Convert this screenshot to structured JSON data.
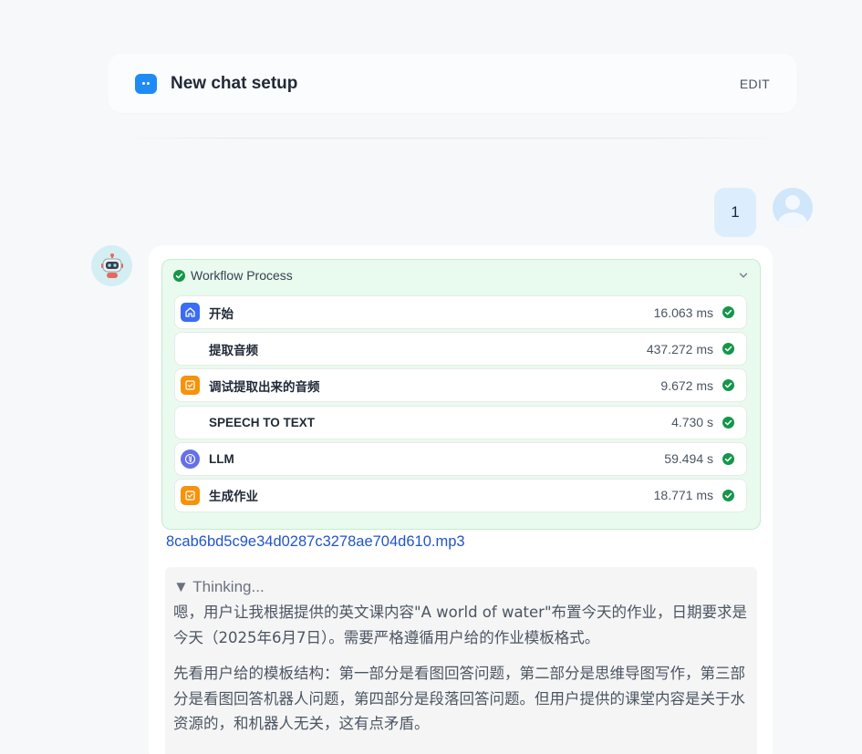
{
  "header": {
    "title": "New chat setup",
    "edit_label": "EDIT"
  },
  "user_message": {
    "text": "1"
  },
  "workflow": {
    "title": "Workflow Process",
    "status_color": "#22a355",
    "nodes": [
      {
        "name": "开始",
        "time": "16.063 ms",
        "icon": "home-icon",
        "icon_color": "#3b6cf6"
      },
      {
        "name": "提取音频",
        "time": "437.272 ms",
        "icon": "blank-icon",
        "icon_color": "#ffffff"
      },
      {
        "name": "调试提取出来的音频",
        "time": "9.672 ms",
        "icon": "code-icon",
        "icon_color": "#f5930b"
      },
      {
        "name": "SPEECH TO TEXT",
        "time": "4.730 s",
        "icon": "blank-icon",
        "icon_color": "#ffffff"
      },
      {
        "name": "LLM",
        "time": "59.494 s",
        "icon": "llm-icon",
        "icon_color": "#6470e8"
      },
      {
        "name": "生成作业",
        "time": "18.771 ms",
        "icon": "code-icon",
        "icon_color": "#f5930b"
      }
    ]
  },
  "file": {
    "name": "8cab6bd5c9e34d0287c3278ae704d610.mp3"
  },
  "thinking": {
    "toggle_label": "▼ Thinking...",
    "paragraphs": [
      "嗯，用户让我根据提供的英文课内容\"A world of water\"布置今天的作业，日期要求是今天（2025年6月7日）。需要严格遵循用户给的作业模板格式。",
      "先看用户给的模板结构：第一部分是看图回答问题，第二部分是思维导图写作，第三部分是看图回答机器人问题，第四部分是段落回答问题。但用户提供的课堂内容是关于水资源的，和机器人无关，这有点矛盾。"
    ]
  }
}
